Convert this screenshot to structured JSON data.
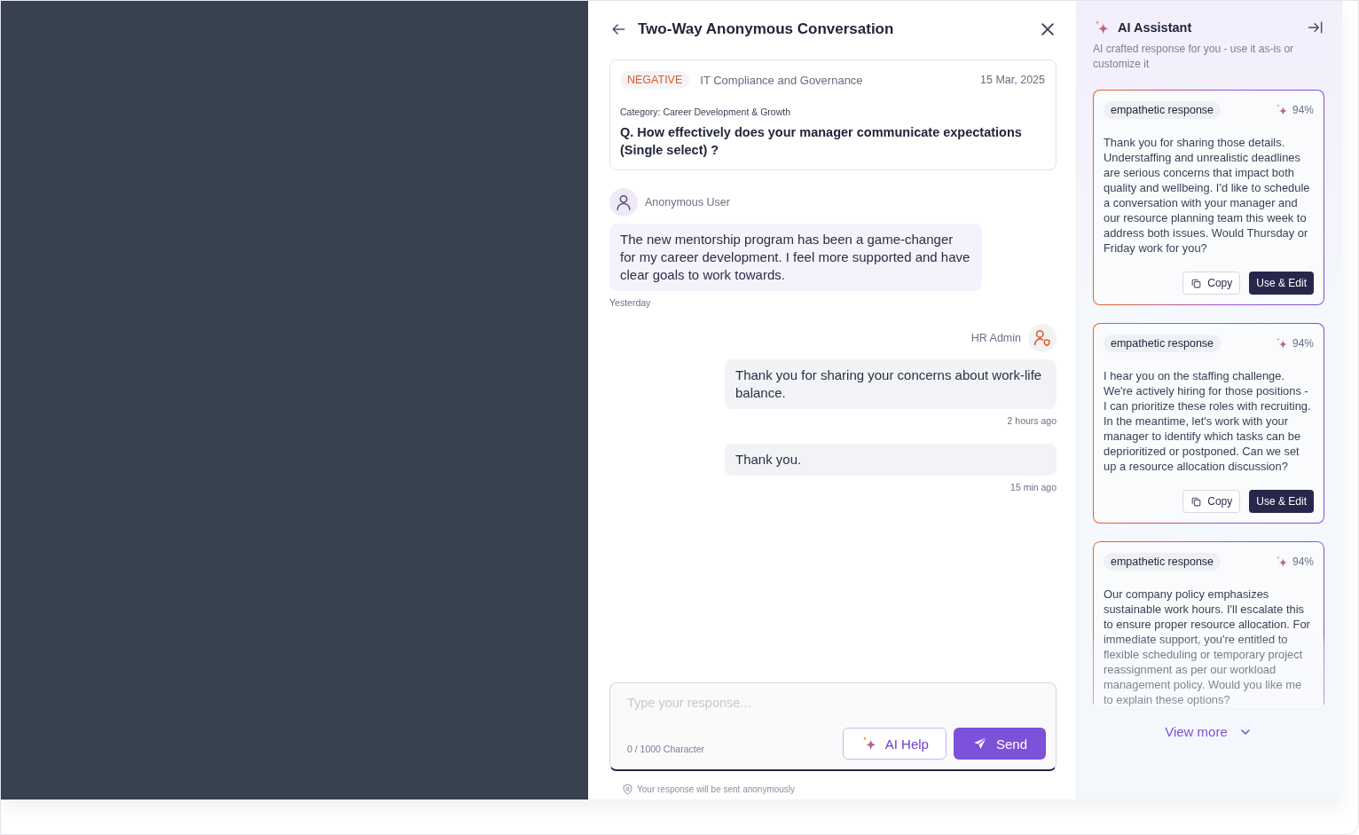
{
  "conversation": {
    "title": "Two-Way Anonymous Conversation",
    "question_card": {
      "sentiment": "NEGATIVE",
      "department": "IT Compliance and Governance",
      "date": "15 Mar, 2025",
      "category": "Category: Career Development & Growth",
      "question": "Q. How effectively does your manager communicate expectations (Single select) ?"
    },
    "messages": [
      {
        "kind": "incoming",
        "sender": "Anonymous User",
        "text": "The new mentorship program has been a game-changer for my career development. I feel more supported and have clear goals to work towards.",
        "time": "Yesterday"
      },
      {
        "kind": "outgoing",
        "sender": "HR Admin",
        "text": "Thank you for sharing your concerns about work-life balance.",
        "time": "2 hours ago"
      },
      {
        "kind": "outgoing",
        "text": "Thank you.",
        "time": "15 min ago"
      }
    ],
    "composer": {
      "placeholder": "Type your response...",
      "counter": "0 / 1000 Character",
      "ai_help_button": "AI Help",
      "send_button": "Send",
      "note": "Your response will be sent anonymously"
    }
  },
  "ai_assistant": {
    "title": "AI Assistant",
    "subtitle": "AI crafted response for you - use it as-is or customize it",
    "suggestions": [
      {
        "tag": "empathetic response",
        "score": "94%",
        "text": "Thank you for sharing those details. Understaffing and unrealistic deadlines are serious concerns that impact both quality and wellbeing. I'd like to schedule a conversation with your manager and our resource planning team this week to address both issues. Would Thursday or Friday work for you?",
        "faded": false,
        "copy_button": "Copy",
        "use_button": "Use & Edit"
      },
      {
        "tag": "empathetic response",
        "score": "94%",
        "text": "I hear you on the staffing challenge. We're actively hiring for those positions - I can prioritize these roles with recruiting. In the meantime, let's work with your manager to identify which tasks can be deprioritized or postponed. Can we set up a resource allocation discussion?",
        "faded": false,
        "copy_button": "Copy",
        "use_button": "Use & Edit"
      },
      {
        "tag": "empathetic response",
        "score": "94%",
        "text": "Our company policy emphasizes sustainable work hours. I'll escalate this to ensure proper resource allocation. For immediate support, you're entitled to flexible scheduling or temporary project reassignment as per our workload management policy. Would you like me to explain these options?",
        "faded": true
      }
    ],
    "view_more": "View more"
  }
}
